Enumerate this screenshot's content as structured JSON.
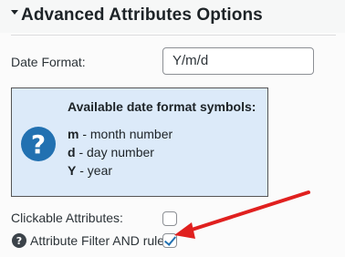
{
  "section": {
    "title": "Advanced Attributes Options"
  },
  "date_format": {
    "label": "Date Format:",
    "value": "Y/m/d"
  },
  "info_box": {
    "title": "Available date format symbols:",
    "symbols": [
      {
        "key": "m",
        "desc": " - month number"
      },
      {
        "key": "d",
        "desc": " - day number"
      },
      {
        "key": "Y",
        "desc": " - year"
      }
    ]
  },
  "options": {
    "clickable_label": "Clickable Attributes:",
    "clickable_checked": false,
    "filter_label": "Attribute Filter AND rule:",
    "filter_checked": true
  },
  "icons": {
    "info": "question-circle-icon",
    "help": "question-circle-icon",
    "caret": "caret-down-icon"
  },
  "colors": {
    "accent": "#2271b1",
    "info_bg": "#dceaf9",
    "annotation_arrow": "#e0201f"
  }
}
